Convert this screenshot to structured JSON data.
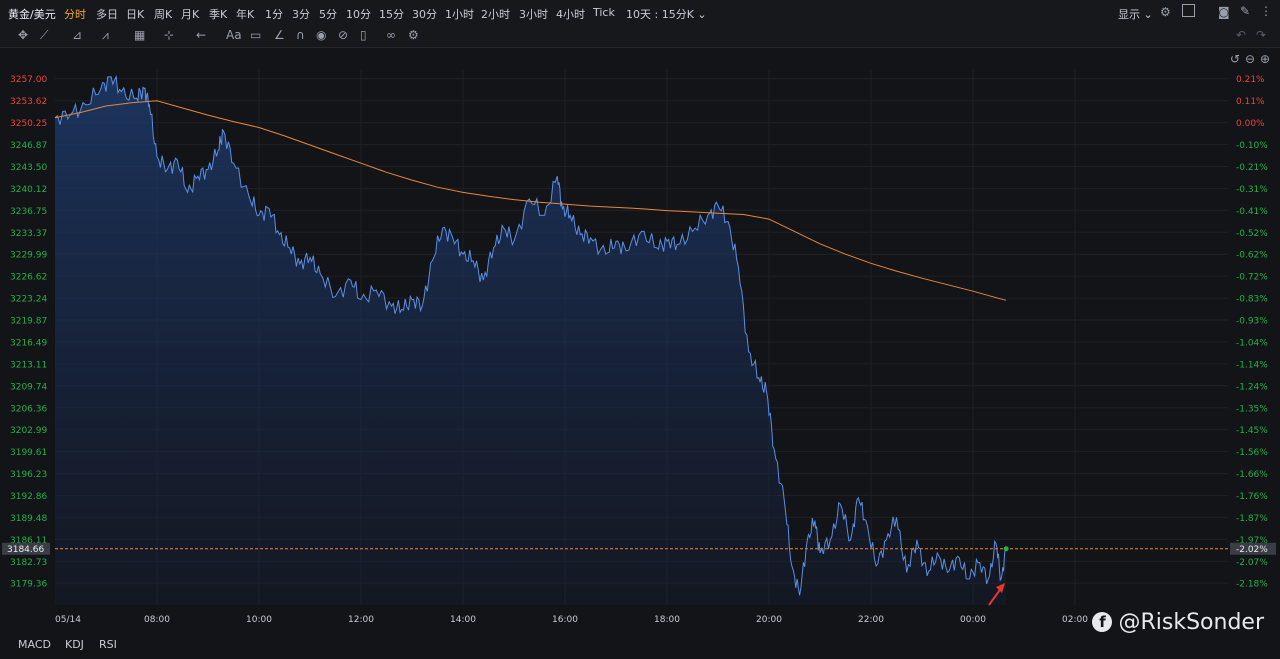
{
  "header": {
    "symbol": "黄金/美元",
    "periods": [
      "分时",
      "多日",
      "日K",
      "周K",
      "月K",
      "季K",
      "年K",
      "1分",
      "3分",
      "5分",
      "10分",
      "15分",
      "30分",
      "1小时",
      "2小时",
      "3小时",
      "4小时",
      "Tick"
    ],
    "active_period": "分时",
    "range_label": "10天 : 15分K",
    "display_label": "显示"
  },
  "bottom_tabs": [
    "MACD",
    "KDJ",
    "RSI"
  ],
  "watermark": "@RiskSonder",
  "colors": {
    "price_line": "#5b8fe6",
    "avg_line": "#e8873a",
    "up": "#e8463c",
    "down": "#26b04a",
    "current_marker": "#e8873a"
  },
  "chart_data": {
    "type": "area",
    "y_ticks": [
      "3257.00",
      "3253.62",
      "3250.25",
      "3246.87",
      "3243.50",
      "3240.12",
      "3236.75",
      "3233.37",
      "3229.99",
      "3226.62",
      "3223.24",
      "3219.87",
      "3216.49",
      "3213.11",
      "3209.74",
      "3206.36",
      "3202.99",
      "3199.61",
      "3196.23",
      "3192.86",
      "3189.48",
      "3186.11",
      "3182.73",
      "3179.36"
    ],
    "y_tick_values": [
      3257.0,
      3253.62,
      3250.25,
      3246.87,
      3243.5,
      3240.12,
      3236.75,
      3233.37,
      3229.99,
      3226.62,
      3223.24,
      3219.87,
      3216.49,
      3213.11,
      3209.74,
      3206.36,
      3202.99,
      3199.61,
      3196.23,
      3192.86,
      3189.48,
      3186.11,
      3182.73,
      3179.36
    ],
    "pct_ticks": [
      "0.21%",
      "0.11%",
      "0.00%",
      "-0.10%",
      "-0.21%",
      "-0.31%",
      "-0.41%",
      "-0.52%",
      "-0.62%",
      "-0.72%",
      "-0.83%",
      "-0.93%",
      "-1.04%",
      "-1.14%",
      "-1.24%",
      "-1.35%",
      "-1.45%",
      "-1.56%",
      "-1.66%",
      "-1.76%",
      "-1.87%",
      "-1.97%",
      "-2.07%",
      "-2.18%"
    ],
    "x_labels": [
      "05/14",
      "08:00",
      "10:00",
      "12:00",
      "14:00",
      "16:00",
      "18:00",
      "20:00",
      "22:00",
      "00:00",
      "02:00"
    ],
    "x_label_hours": [
      6.0,
      8,
      10,
      12,
      14,
      16,
      18,
      20,
      22,
      24,
      26
    ],
    "x_range_hours": [
      6.0,
      29.0
    ],
    "ylim": [
      3176.0,
      3258.5
    ],
    "current_price": "3184.66",
    "current_pct": "-2.02%",
    "price_series": {
      "t": [
        6.0,
        6.3,
        6.6,
        6.9,
        7.1,
        7.3,
        7.6,
        7.75,
        7.85,
        8.0,
        8.2,
        8.4,
        8.6,
        8.8,
        9.0,
        9.2,
        9.3,
        9.5,
        9.8,
        10.0,
        10.2,
        10.4,
        10.6,
        10.8,
        11.0,
        11.2,
        11.5,
        11.8,
        12.0,
        12.3,
        12.6,
        12.8,
        13.0,
        13.2,
        13.4,
        13.6,
        13.8,
        14.0,
        14.2,
        14.4,
        14.6,
        14.8,
        15.0,
        15.3,
        15.6,
        15.85,
        15.95,
        16.1,
        16.3,
        16.5,
        16.8,
        17.0,
        17.2,
        17.5,
        17.8,
        18.0,
        18.2,
        18.5,
        18.8,
        19.0,
        19.2,
        19.4,
        19.6,
        19.8,
        19.95,
        20.1,
        20.3,
        20.45,
        20.6,
        20.75,
        20.9,
        21.0,
        21.2,
        21.4,
        21.6,
        21.75,
        21.9,
        22.1,
        22.3,
        22.5,
        22.7,
        22.9,
        23.1,
        23.3,
        23.5,
        23.7,
        23.9,
        24.1,
        24.3,
        24.45,
        24.55,
        24.65
      ],
      "v": [
        3251.0,
        3251.5,
        3253.0,
        3255.5,
        3257.3,
        3255.0,
        3254.0,
        3255.5,
        3253.0,
        3245.0,
        3243.0,
        3244.5,
        3239.5,
        3242.0,
        3243.0,
        3246.0,
        3249.0,
        3244.0,
        3239.0,
        3236.0,
        3237.0,
        3233.0,
        3231.0,
        3228.5,
        3229.5,
        3227.0,
        3223.5,
        3226.0,
        3223.0,
        3224.5,
        3222.0,
        3221.5,
        3223.0,
        3222.0,
        3229.0,
        3234.0,
        3232.5,
        3230.0,
        3229.0,
        3226.0,
        3231.0,
        3234.0,
        3232.0,
        3238.5,
        3236.0,
        3242.0,
        3237.0,
        3236.0,
        3233.0,
        3232.5,
        3230.0,
        3232.0,
        3230.5,
        3233.5,
        3231.0,
        3232.0,
        3231.5,
        3233.5,
        3236.0,
        3237.5,
        3235.0,
        3228.0,
        3215.0,
        3211.0,
        3209.0,
        3200.0,
        3192.0,
        3182.0,
        3177.5,
        3186.0,
        3189.0,
        3184.0,
        3186.0,
        3191.5,
        3186.0,
        3192.5,
        3189.0,
        3182.0,
        3186.0,
        3189.5,
        3181.0,
        3186.0,
        3180.5,
        3184.0,
        3181.0,
        3183.5,
        3180.0,
        3182.5,
        3180.0,
        3185.5,
        3180.0,
        3184.66
      ]
    },
    "avg_series": {
      "t": [
        6.0,
        6.5,
        7.0,
        7.5,
        8.0,
        8.5,
        9.0,
        9.5,
        10.0,
        10.5,
        11.0,
        11.5,
        12.0,
        12.5,
        13.0,
        13.5,
        14.0,
        14.5,
        15.0,
        15.5,
        16.0,
        16.5,
        17.0,
        17.5,
        18.0,
        18.5,
        19.0,
        19.5,
        20.0,
        20.5,
        21.0,
        21.5,
        22.0,
        22.5,
        23.0,
        23.5,
        24.0,
        24.5,
        24.65
      ],
      "v": [
        3251.0,
        3251.8,
        3252.8,
        3253.3,
        3253.6,
        3252.5,
        3251.4,
        3250.4,
        3249.5,
        3248.2,
        3246.8,
        3245.4,
        3244.0,
        3242.6,
        3241.4,
        3240.3,
        3239.5,
        3238.9,
        3238.4,
        3238.0,
        3237.7,
        3237.4,
        3237.2,
        3237.0,
        3236.7,
        3236.5,
        3236.3,
        3236.1,
        3235.4,
        3233.5,
        3231.6,
        3230.0,
        3228.6,
        3227.4,
        3226.3,
        3225.3,
        3224.3,
        3223.2,
        3222.9
      ]
    }
  }
}
